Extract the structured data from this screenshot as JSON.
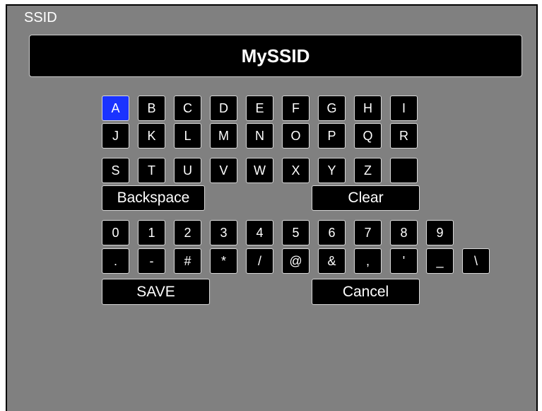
{
  "title": "SSID",
  "ssid_value": "MySSID",
  "keyboard": {
    "row1": [
      "A",
      "B",
      "C",
      "D",
      "E",
      "F",
      "G",
      "H",
      "I"
    ],
    "row2": [
      "J",
      "K",
      "L",
      "M",
      "N",
      "O",
      "P",
      "Q",
      "R"
    ],
    "row3": [
      "S",
      "T",
      "U",
      "V",
      "W",
      "X",
      "Y",
      "Z",
      ""
    ],
    "digits": [
      "0",
      "1",
      "2",
      "3",
      "4",
      "5",
      "6",
      "7",
      "8",
      "9"
    ],
    "symbols": [
      ".",
      "-",
      "#",
      "*",
      "/",
      "@",
      "&",
      ",",
      "'",
      "_",
      "\\"
    ],
    "selected_key": "A"
  },
  "buttons": {
    "backspace": "Backspace",
    "clear": "Clear",
    "save": "SAVE",
    "cancel": "Cancel"
  },
  "colors": {
    "background": "#808080",
    "key": "#000000",
    "selected_key": "#1a33ff",
    "text": "#ffffff"
  }
}
